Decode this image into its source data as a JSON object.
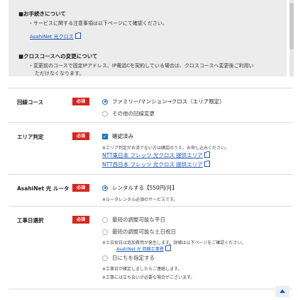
{
  "notice": {
    "sections": [
      {
        "title": "■お手続きについて",
        "text": "・サービスに関する注意事項は以下ページにて確認ください。",
        "link": "AsahiNet 光クロス"
      },
      {
        "title": "■クロスコースへの変更について",
        "text": "・変更前のコースで固定IPアドレス、IP電話Cを契約している場合は、クロスコースへ変更後ご利用い",
        "text2": "ただけなくなります。"
      }
    ]
  },
  "form": {
    "required_label": "必須",
    "line_course": {
      "label": "回線コース",
      "options": [
        "ファミリー/マンション→クロス（エリア限定）",
        "その他の回線変更"
      ]
    },
    "area": {
      "label": "エリア判定",
      "checkbox": "確認済み",
      "note": "※エリア判定がお済でない方は確認のうえ、お申し込みください。",
      "links": [
        "NTT東日本 フレッツ 光クロス 提供エリア",
        "NTT西日本 フレッツ 光クロス 提供エリア"
      ]
    },
    "router": {
      "label": "AsahiNet 光 ルータ",
      "option": "レンタルする【550円/月】",
      "note": "※ルータレンタル必須のサービスです。"
    },
    "construction": {
      "label": "工事日選択",
      "options": [
        "最短の調整可能な平日",
        "最短の調整可能な土日祝日",
        "日にちを指定する"
      ],
      "note1": "※土日祝日は追加費用が発生します。詳細は以下ページをご確認ください。",
      "link": "AsahiNet 光 回線工事費",
      "note2": "※工事日が確定しましたらご連絡します。",
      "note3": "※工事には立ち会いが必要な場合がございます。"
    }
  },
  "colors": {
    "accent": "#1a6fc9",
    "required_bg": "#d9251d",
    "notice_bg": "#ececec"
  }
}
